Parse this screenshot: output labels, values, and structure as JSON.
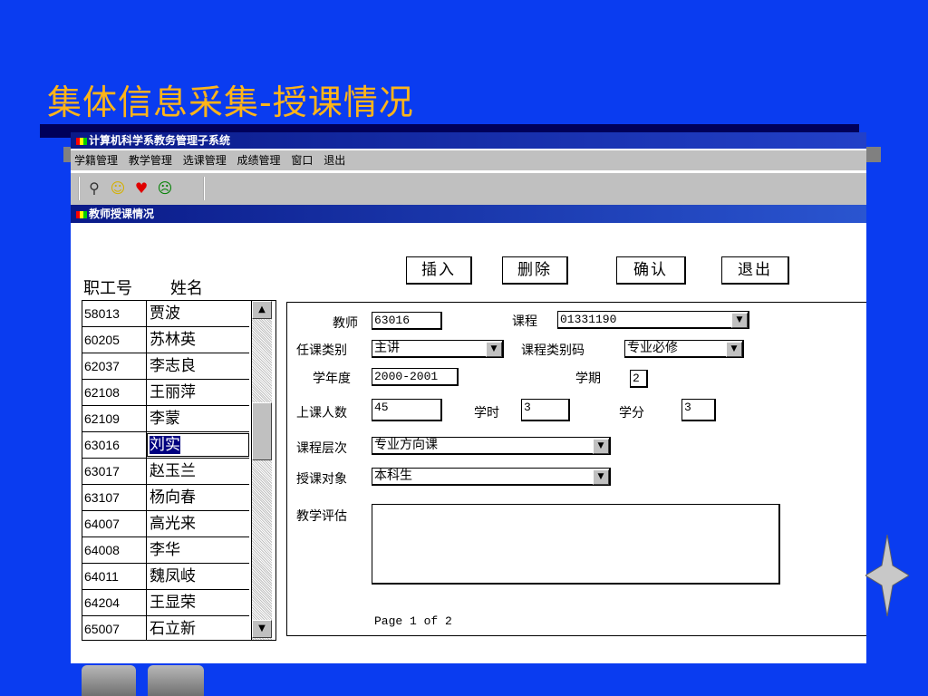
{
  "slide": {
    "title": "集体信息采集-授课情况"
  },
  "app": {
    "title": "计算机科学系教务管理子系统"
  },
  "menu": [
    "学籍管理",
    "教学管理",
    "选课管理",
    "成绩管理",
    "窗口",
    "退出"
  ],
  "toolbar": {
    "icons": [
      "search-person-icon",
      "smiley-icon",
      "heart-icon",
      "sad-face-icon"
    ]
  },
  "form": {
    "title": "教师授课情况"
  },
  "list": {
    "headers": [
      "职工号",
      "姓名"
    ],
    "rows": [
      {
        "id": "58013",
        "name": "贾波"
      },
      {
        "id": "60205",
        "name": "苏林英"
      },
      {
        "id": "62037",
        "name": "李志良"
      },
      {
        "id": "62108",
        "name": "王丽萍"
      },
      {
        "id": "62109",
        "name": "李蒙"
      },
      {
        "id": "63016",
        "name": "刘实"
      },
      {
        "id": "63017",
        "name": "赵玉兰"
      },
      {
        "id": "63107",
        "name": "杨向春"
      },
      {
        "id": "64007",
        "name": "高光来"
      },
      {
        "id": "64008",
        "name": "李华"
      },
      {
        "id": "64011",
        "name": "魏凤岐"
      },
      {
        "id": "64204",
        "name": "王显荣"
      },
      {
        "id": "65007",
        "name": "石立新"
      }
    ],
    "selected": "63016"
  },
  "buttons": {
    "insert": "插入",
    "delete": "删除",
    "confirm": "确认",
    "exit": "退出"
  },
  "fields": {
    "teacher": {
      "label": "教师",
      "value": "63016"
    },
    "course": {
      "label": "课程",
      "value": "01331190"
    },
    "role": {
      "label": "任课类别",
      "value": "主讲"
    },
    "course_type_code": {
      "label": "课程类别码",
      "value": "专业必修"
    },
    "school_year": {
      "label": "学年度",
      "value": "2000-2001"
    },
    "term": {
      "label": "学期",
      "value": "2"
    },
    "students": {
      "label": "上课人数",
      "value": "45"
    },
    "hours": {
      "label": "学时",
      "value": "3"
    },
    "credits": {
      "label": "学分",
      "value": "3"
    },
    "level": {
      "label": "课程层次",
      "value": "专业方向课"
    },
    "audience": {
      "label": "授课对象",
      "value": "本科生"
    },
    "evaluation": {
      "label": "教学评估",
      "value": ""
    }
  },
  "pager": {
    "text": "Page 1 of 2"
  },
  "colors": {
    "background": "#0a3cf0",
    "title": "#ffb419",
    "selection": "#000080"
  }
}
